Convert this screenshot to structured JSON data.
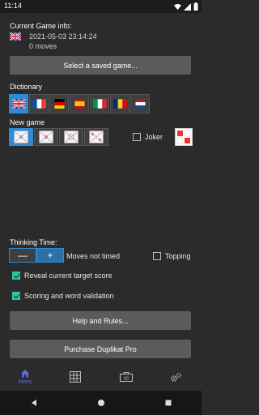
{
  "status": {
    "time": "11:14"
  },
  "game_info": {
    "title": "Current Game info:",
    "date": "2021-05-03 23:14:24",
    "moves": "0 moves"
  },
  "select_game_label": "Select a saved game...",
  "dictionary": {
    "title": "Dictionary",
    "flags": [
      {
        "name": "uk",
        "selected": true
      },
      {
        "name": "france",
        "selected": false
      },
      {
        "name": "germany",
        "selected": false
      },
      {
        "name": "spain",
        "selected": false
      },
      {
        "name": "italy",
        "selected": false
      },
      {
        "name": "romania",
        "selected": false
      },
      {
        "name": "netherlands",
        "selected": false
      }
    ]
  },
  "new_game": {
    "title": "New game",
    "joker_label": "Joker"
  },
  "thinking": {
    "title": "Thinking Time:",
    "minus": "—",
    "plus": "+",
    "value": "Moves not timed",
    "topping_label": "Topping"
  },
  "options": {
    "reveal_label": "Reveal current target score",
    "scoring_label": "Scoring and word validation"
  },
  "help_label": "Help and Rules...",
  "purchase_label": "Purchase Duplikat Pro",
  "nav": {
    "menu_label": "Menu"
  },
  "colors": {
    "accent": "#2e8bd6",
    "check": "#2ec4a6",
    "nav_active": "#5b6bd6"
  }
}
